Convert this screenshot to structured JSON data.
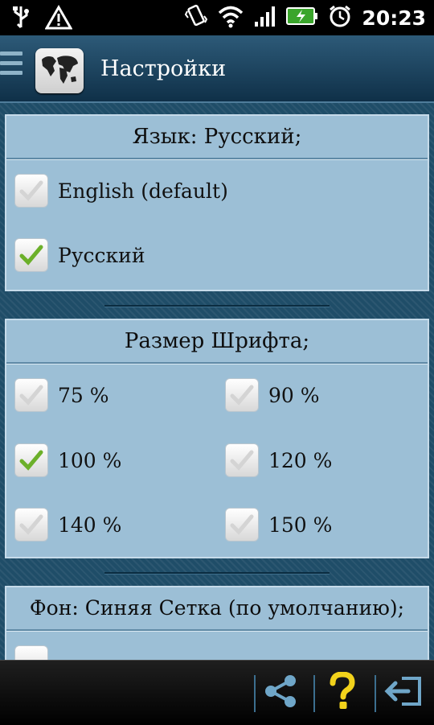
{
  "status_bar": {
    "time": "20:23"
  },
  "header": {
    "title": "Настройки"
  },
  "language": {
    "header": "Язык: Русский;",
    "options": [
      {
        "label": "English (default)",
        "checked": false
      },
      {
        "label": "Русский",
        "checked": true
      }
    ]
  },
  "font_size": {
    "header": "Размер Шрифта;",
    "options": [
      {
        "label": "75 %",
        "checked": false
      },
      {
        "label": "90 %",
        "checked": false
      },
      {
        "label": "100 %",
        "checked": true
      },
      {
        "label": "120 %",
        "checked": false
      },
      {
        "label": "140 %",
        "checked": false
      },
      {
        "label": "150 %",
        "checked": false
      }
    ]
  },
  "background": {
    "header": "Фон: Синяя Сетка (по умолчанию);"
  },
  "colors": {
    "accent_check": "#6cb02a",
    "panel": "#9cbfd6",
    "help_icon": "#f2d21b"
  },
  "icons": [
    "usb-icon",
    "warning-icon",
    "vibrate-icon",
    "wifi-icon",
    "signal-icon",
    "battery-icon",
    "alarm-icon",
    "menu-icon",
    "world-map-icon",
    "share-icon",
    "help-icon",
    "exit-icon"
  ]
}
